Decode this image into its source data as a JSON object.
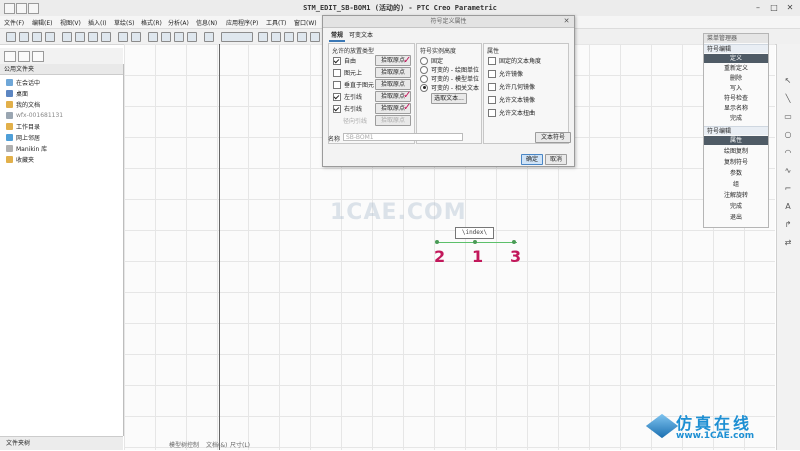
{
  "window": {
    "title": "STM_EDIT_SB-BOM1 (活动的) - PTC Creo Parametric",
    "controls": [
      "–",
      "□",
      "✕"
    ]
  },
  "menubar": [
    "文件(F)",
    "编辑(E)",
    "视图(V)",
    "插入(I)",
    "草绘(S)",
    "格式(R)",
    "分析(A)",
    "信息(N)",
    "应用程序(P)",
    "工具(T)",
    "窗口(W)"
  ],
  "navigator": {
    "header": "公用文件夹",
    "items": [
      "在会话中",
      "桌面",
      "我的文档",
      "wfx-001681131",
      "工作目录",
      "网上邻居",
      "Manikin 库",
      "收藏夹"
    ],
    "footer": "文件夹树"
  },
  "status": {
    "left": "模型树控制",
    "mid": "文档(&)",
    "right": "尺寸(L)"
  },
  "dialog": {
    "title": "符号定义属性",
    "tabs": [
      "常规",
      "可变文本"
    ],
    "group_placement": {
      "label": "允许的放置类型",
      "rows": [
        {
          "label": "自由",
          "checked": true,
          "button": "拾取原点"
        },
        {
          "label": "图元上",
          "checked": false,
          "button": "拾取原点"
        },
        {
          "label": "垂直于图元",
          "checked": false,
          "button": "拾取原点"
        },
        {
          "label": "左引线",
          "checked": true,
          "button": "拾取原点"
        },
        {
          "label": "右引线",
          "checked": true,
          "button": "拾取原点"
        },
        {
          "label": "径向引线",
          "checked": false,
          "button": "拾取原点"
        }
      ]
    },
    "group_height": {
      "label": "符号实例高度",
      "options": [
        {
          "label": "固定",
          "selected": false
        },
        {
          "label": "可变的 - 绘图单位",
          "selected": false
        },
        {
          "label": "可变的 - 模型单位",
          "selected": false
        },
        {
          "label": "可变的 - 相关文本",
          "selected": true
        }
      ],
      "button": "选取文本..."
    },
    "group_props": {
      "label": "属性",
      "items": [
        "固定的文本角度",
        "允许镜像",
        "允许几何镜像",
        "允许文本镜像",
        "允许文本扭曲"
      ]
    },
    "name_label": "名称",
    "name_placeholder": "SB-BOM1",
    "text_symbol_button": "文本符号",
    "ok_button": "确定",
    "cancel_button": "取消"
  },
  "menu_manager": {
    "header": "菜单管理器",
    "section1": "符号编辑",
    "section1_items": [
      "定义",
      "重新定义",
      "删除",
      "写入",
      "符号检查",
      "显示名称",
      "完成"
    ],
    "section2": "符号编辑",
    "section2_items": [
      "属性",
      "绘图复制",
      "复制符号",
      "参数",
      "组",
      "注解旋转",
      "完成",
      "退出"
    ],
    "selected": [
      "定义",
      "属性"
    ]
  },
  "canvas": {
    "symbol_text": "\\index\\",
    "handwritten": [
      "2",
      "1",
      "3"
    ],
    "watermark": "1CAE.COM"
  },
  "brand": {
    "line1": "仿真在线",
    "line2": "www.1CAE.com"
  }
}
